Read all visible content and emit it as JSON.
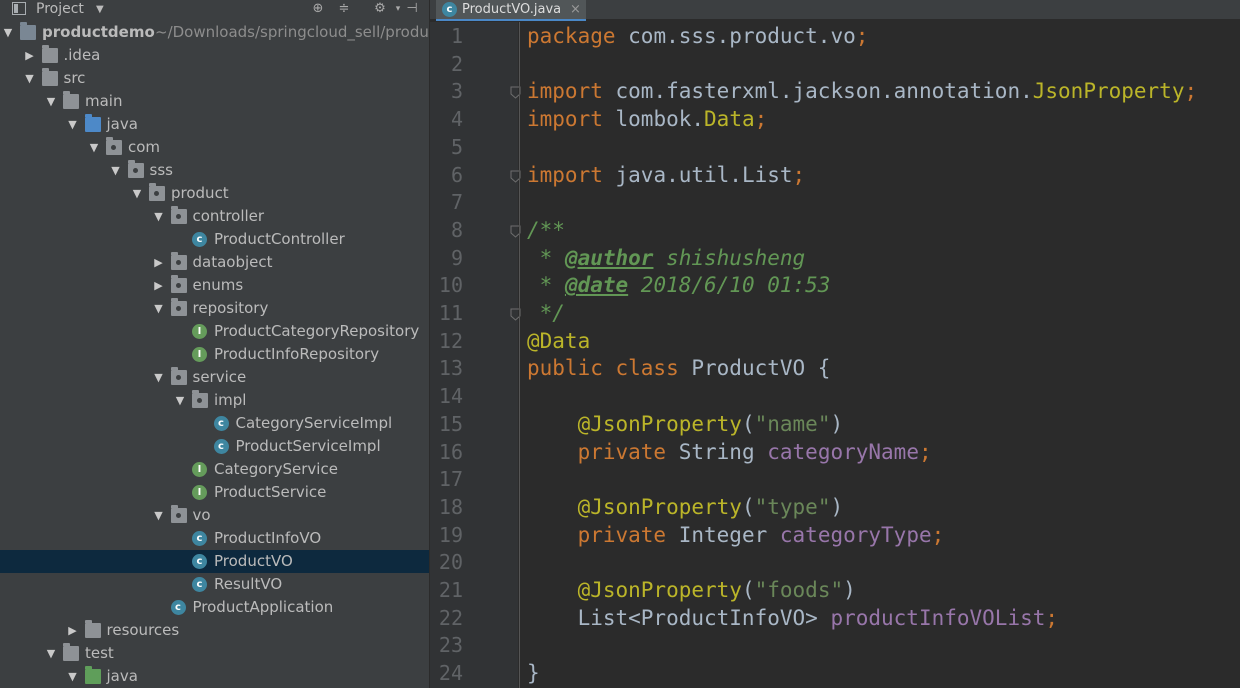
{
  "project_panel": {
    "title": "Project",
    "header_icons": [
      "crosshair-icon",
      "collapse-icon",
      "gear-icon",
      "pin-icon"
    ],
    "tree": [
      {
        "label": "productdemo",
        "path": "~/Downloads/springcloud_sell/produc",
        "expanded": true,
        "icon": "module-icon"
      },
      {
        "label": ".idea",
        "expanded": false,
        "icon": "folder-icon"
      },
      {
        "label": "src",
        "expanded": true,
        "icon": "folder-icon"
      },
      {
        "label": "main",
        "expanded": true,
        "icon": "folder-icon"
      },
      {
        "label": "java",
        "expanded": true,
        "icon": "source-folder-icon"
      },
      {
        "label": "com",
        "expanded": true,
        "icon": "package-icon"
      },
      {
        "label": "sss",
        "expanded": true,
        "icon": "package-icon"
      },
      {
        "label": "product",
        "expanded": true,
        "icon": "package-icon"
      },
      {
        "label": "controller",
        "expanded": true,
        "icon": "package-icon"
      },
      {
        "label": "ProductController",
        "icon": "class-icon"
      },
      {
        "label": "dataobject",
        "expanded": false,
        "icon": "package-icon"
      },
      {
        "label": "enums",
        "expanded": false,
        "icon": "package-icon"
      },
      {
        "label": "repository",
        "expanded": true,
        "icon": "package-icon"
      },
      {
        "label": "ProductCategoryRepository",
        "icon": "interface-icon"
      },
      {
        "label": "ProductInfoRepository",
        "icon": "interface-icon"
      },
      {
        "label": "service",
        "expanded": true,
        "icon": "package-icon"
      },
      {
        "label": "impl",
        "expanded": true,
        "icon": "package-icon"
      },
      {
        "label": "CategoryServiceImpl",
        "icon": "class-icon"
      },
      {
        "label": "ProductServiceImpl",
        "icon": "class-icon"
      },
      {
        "label": "CategoryService",
        "icon": "interface-icon"
      },
      {
        "label": "ProductService",
        "icon": "interface-icon"
      },
      {
        "label": "vo",
        "expanded": true,
        "icon": "package-icon"
      },
      {
        "label": "ProductInfoVO",
        "icon": "class-icon"
      },
      {
        "label": "ProductVO",
        "icon": "class-icon",
        "selected": true
      },
      {
        "label": "ResultVO",
        "icon": "class-icon"
      },
      {
        "label": "ProductApplication",
        "icon": "spring-class-icon"
      },
      {
        "label": "resources",
        "expanded": false,
        "icon": "resources-folder-icon"
      },
      {
        "label": "test",
        "expanded": true,
        "icon": "folder-icon"
      },
      {
        "label": "java",
        "expanded": true,
        "icon": "test-folder-icon"
      }
    ]
  },
  "editor": {
    "tab": {
      "label": "ProductVO.java",
      "close": "×"
    },
    "lines": [
      [
        [
          "kw",
          "package "
        ],
        [
          "txt",
          "com.sss.product.vo"
        ],
        [
          "kw",
          ";"
        ]
      ],
      [],
      [
        [
          "kw",
          "import "
        ],
        [
          "txt",
          "com.fasterxml.jackson.annotation."
        ],
        [
          "ann",
          "JsonProperty"
        ],
        [
          "kw",
          ";"
        ]
      ],
      [
        [
          "kw",
          "import "
        ],
        [
          "txt",
          "lombok."
        ],
        [
          "ann",
          "Data"
        ],
        [
          "kw",
          ";"
        ]
      ],
      [],
      [
        [
          "kw",
          "import "
        ],
        [
          "txt",
          "java.util.List"
        ],
        [
          "kw",
          ";"
        ]
      ],
      [],
      [
        [
          "doc",
          "/**"
        ]
      ],
      [
        [
          "doc",
          " * "
        ],
        [
          "tag",
          "@author"
        ],
        [
          "doc",
          " shishusheng"
        ]
      ],
      [
        [
          "doc",
          " * "
        ],
        [
          "tag",
          "@date"
        ],
        [
          "doc",
          " 2018/6/10 01:53"
        ]
      ],
      [
        [
          "doc",
          " */"
        ]
      ],
      [
        [
          "ann",
          "@Data"
        ]
      ],
      [
        [
          "kw",
          "public class "
        ],
        [
          "txt",
          "ProductVO {"
        ]
      ],
      [],
      [
        [
          "txt",
          "    "
        ],
        [
          "ann",
          "@JsonProperty"
        ],
        [
          "txt",
          "("
        ],
        [
          "str",
          "\"name\""
        ],
        [
          "txt",
          ")"
        ]
      ],
      [
        [
          "txt",
          "    "
        ],
        [
          "kw",
          "private "
        ],
        [
          "txt",
          "String "
        ],
        [
          "fld",
          "categoryName"
        ],
        [
          "kw",
          ";"
        ]
      ],
      [],
      [
        [
          "txt",
          "    "
        ],
        [
          "ann",
          "@JsonProperty"
        ],
        [
          "txt",
          "("
        ],
        [
          "str",
          "\"type\""
        ],
        [
          "txt",
          ")"
        ]
      ],
      [
        [
          "txt",
          "    "
        ],
        [
          "kw",
          "private "
        ],
        [
          "txt",
          "Integer "
        ],
        [
          "fld",
          "categoryType"
        ],
        [
          "kw",
          ";"
        ]
      ],
      [],
      [
        [
          "txt",
          "    "
        ],
        [
          "ann",
          "@JsonProperty"
        ],
        [
          "txt",
          "("
        ],
        [
          "str",
          "\"foods\""
        ],
        [
          "txt",
          ")"
        ]
      ],
      [
        [
          "txt",
          "    List<ProductInfoVO> "
        ],
        [
          "fld",
          "productInfoVOList"
        ],
        [
          "kw",
          ";"
        ]
      ],
      [],
      [
        [
          "txt",
          "}"
        ]
      ]
    ],
    "fold_lines": [
      3,
      6,
      8,
      11
    ]
  }
}
